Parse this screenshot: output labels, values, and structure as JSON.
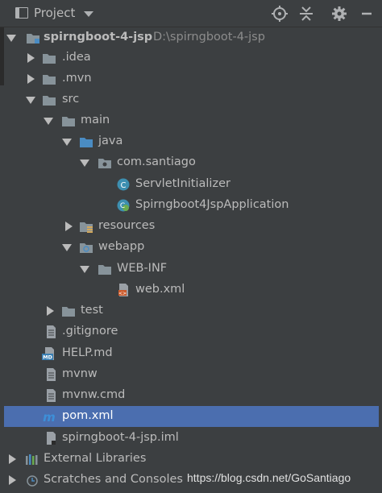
{
  "header": {
    "title": "Project"
  },
  "tree": {
    "root": {
      "name": "spirngboot-4-jsp",
      "path": "D:\\spirngboot-4-jsp"
    },
    "idea": ".idea",
    "mvn": ".mvn",
    "src": "src",
    "main": "main",
    "java": "java",
    "package": "com.santiago",
    "servlet_initializer": "ServletInitializer",
    "application": "Spirngboot4JspApplication",
    "resources": "resources",
    "webapp": "webapp",
    "web_inf": "WEB-INF",
    "web_xml": "web.xml",
    "test": "test",
    "gitignore": ".gitignore",
    "help_md": "HELP.md",
    "mvnw": "mvnw",
    "mvnw_cmd": "mvnw.cmd",
    "pom_xml": "pom.xml",
    "iml": "spirngboot-4-jsp.iml",
    "external_libraries": "External Libraries",
    "scratches": "Scratches and Consoles"
  },
  "watermark": "https://blog.csdn.net/GoSantiago",
  "colors": {
    "background": "#3c3f41",
    "selection": "#4b6eaf",
    "folder": "#87939a",
    "source_folder": "#4a8cc3",
    "class_icon": "#3d8fb0",
    "md_badge": "#3a7fb3",
    "xml_badge": "#cc5a2b"
  }
}
